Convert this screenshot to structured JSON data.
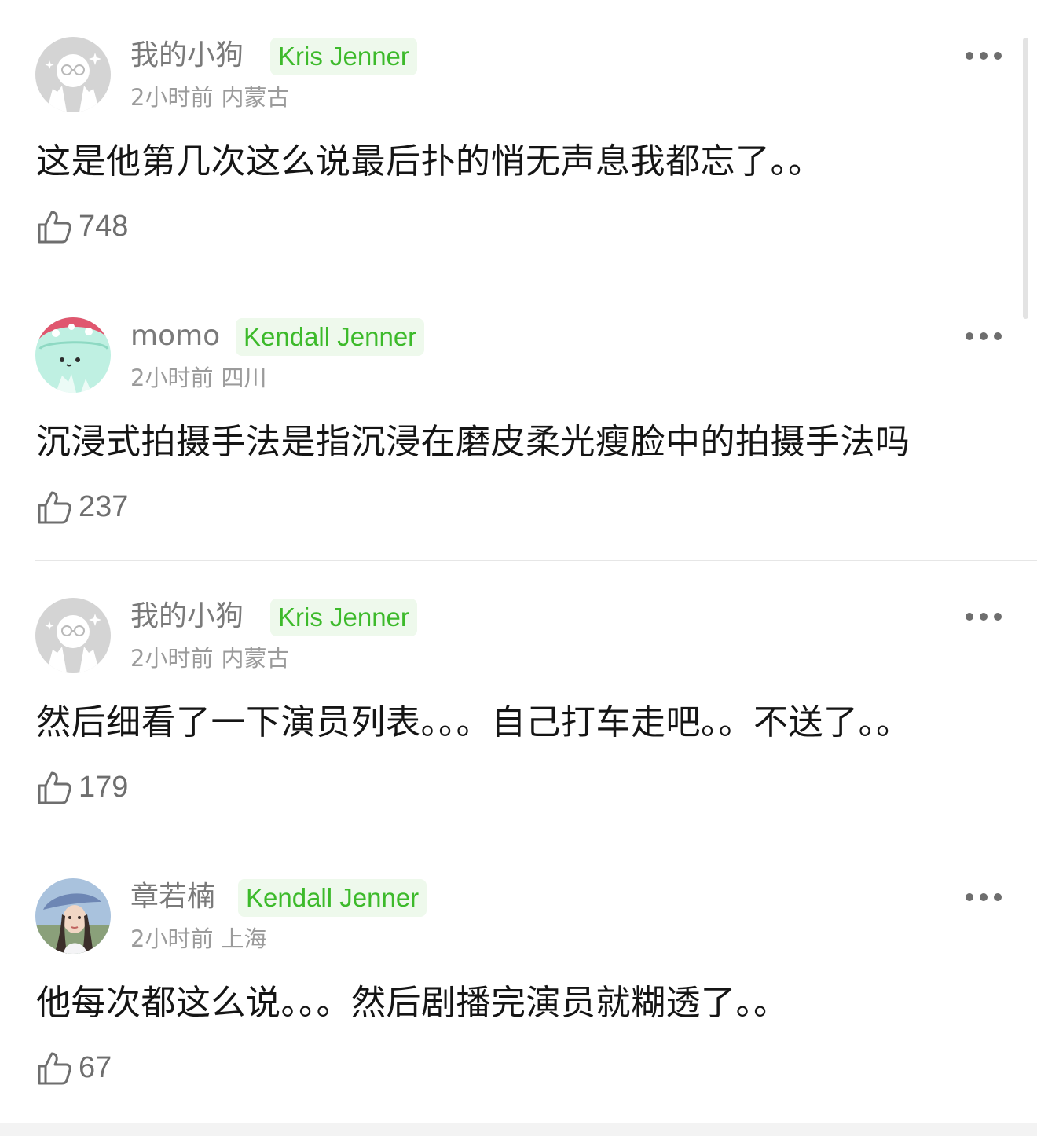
{
  "comments": [
    {
      "username": "我的小狗",
      "tag": "Kris Jenner",
      "time": "2小时前",
      "location": "内蒙古",
      "text": "这是他第几次这么说最后扑的悄无声息我都忘了。。",
      "likes": "748",
      "avatar": "gray-sticker-avatar"
    },
    {
      "username": "momo",
      "tag": "Kendall Jenner",
      "time": "2小时前",
      "location": "四川",
      "text": "沉浸式拍摄手法是指沉浸在磨皮柔光瘦脸中的拍摄手法吗",
      "likes": "237",
      "avatar": "mint-cartoon-avatar"
    },
    {
      "username": "我的小狗",
      "tag": "Kris Jenner",
      "time": "2小时前",
      "location": "内蒙古",
      "text": "然后细看了一下演员列表。。。自己打车走吧。。不送了。。",
      "likes": "179",
      "avatar": "gray-sticker-avatar"
    },
    {
      "username": "章若楠",
      "tag": "Kendall Jenner",
      "time": "2小时前",
      "location": "上海",
      "text": "他每次都这么说。。。然后剧播完演员就糊透了。。",
      "likes": "67",
      "avatar": "photo-avatar"
    }
  ],
  "colors": {
    "tag_text": "#3dba2b",
    "tag_background": "#eef9ec",
    "username": "#7a7a7a",
    "meta": "#9b9b9b",
    "body_text": "#151515",
    "icon": "#6e6e6e",
    "divider": "#e6e6e6"
  },
  "icons": {
    "more": "more-dots-icon",
    "like": "thumbs-up-icon"
  }
}
